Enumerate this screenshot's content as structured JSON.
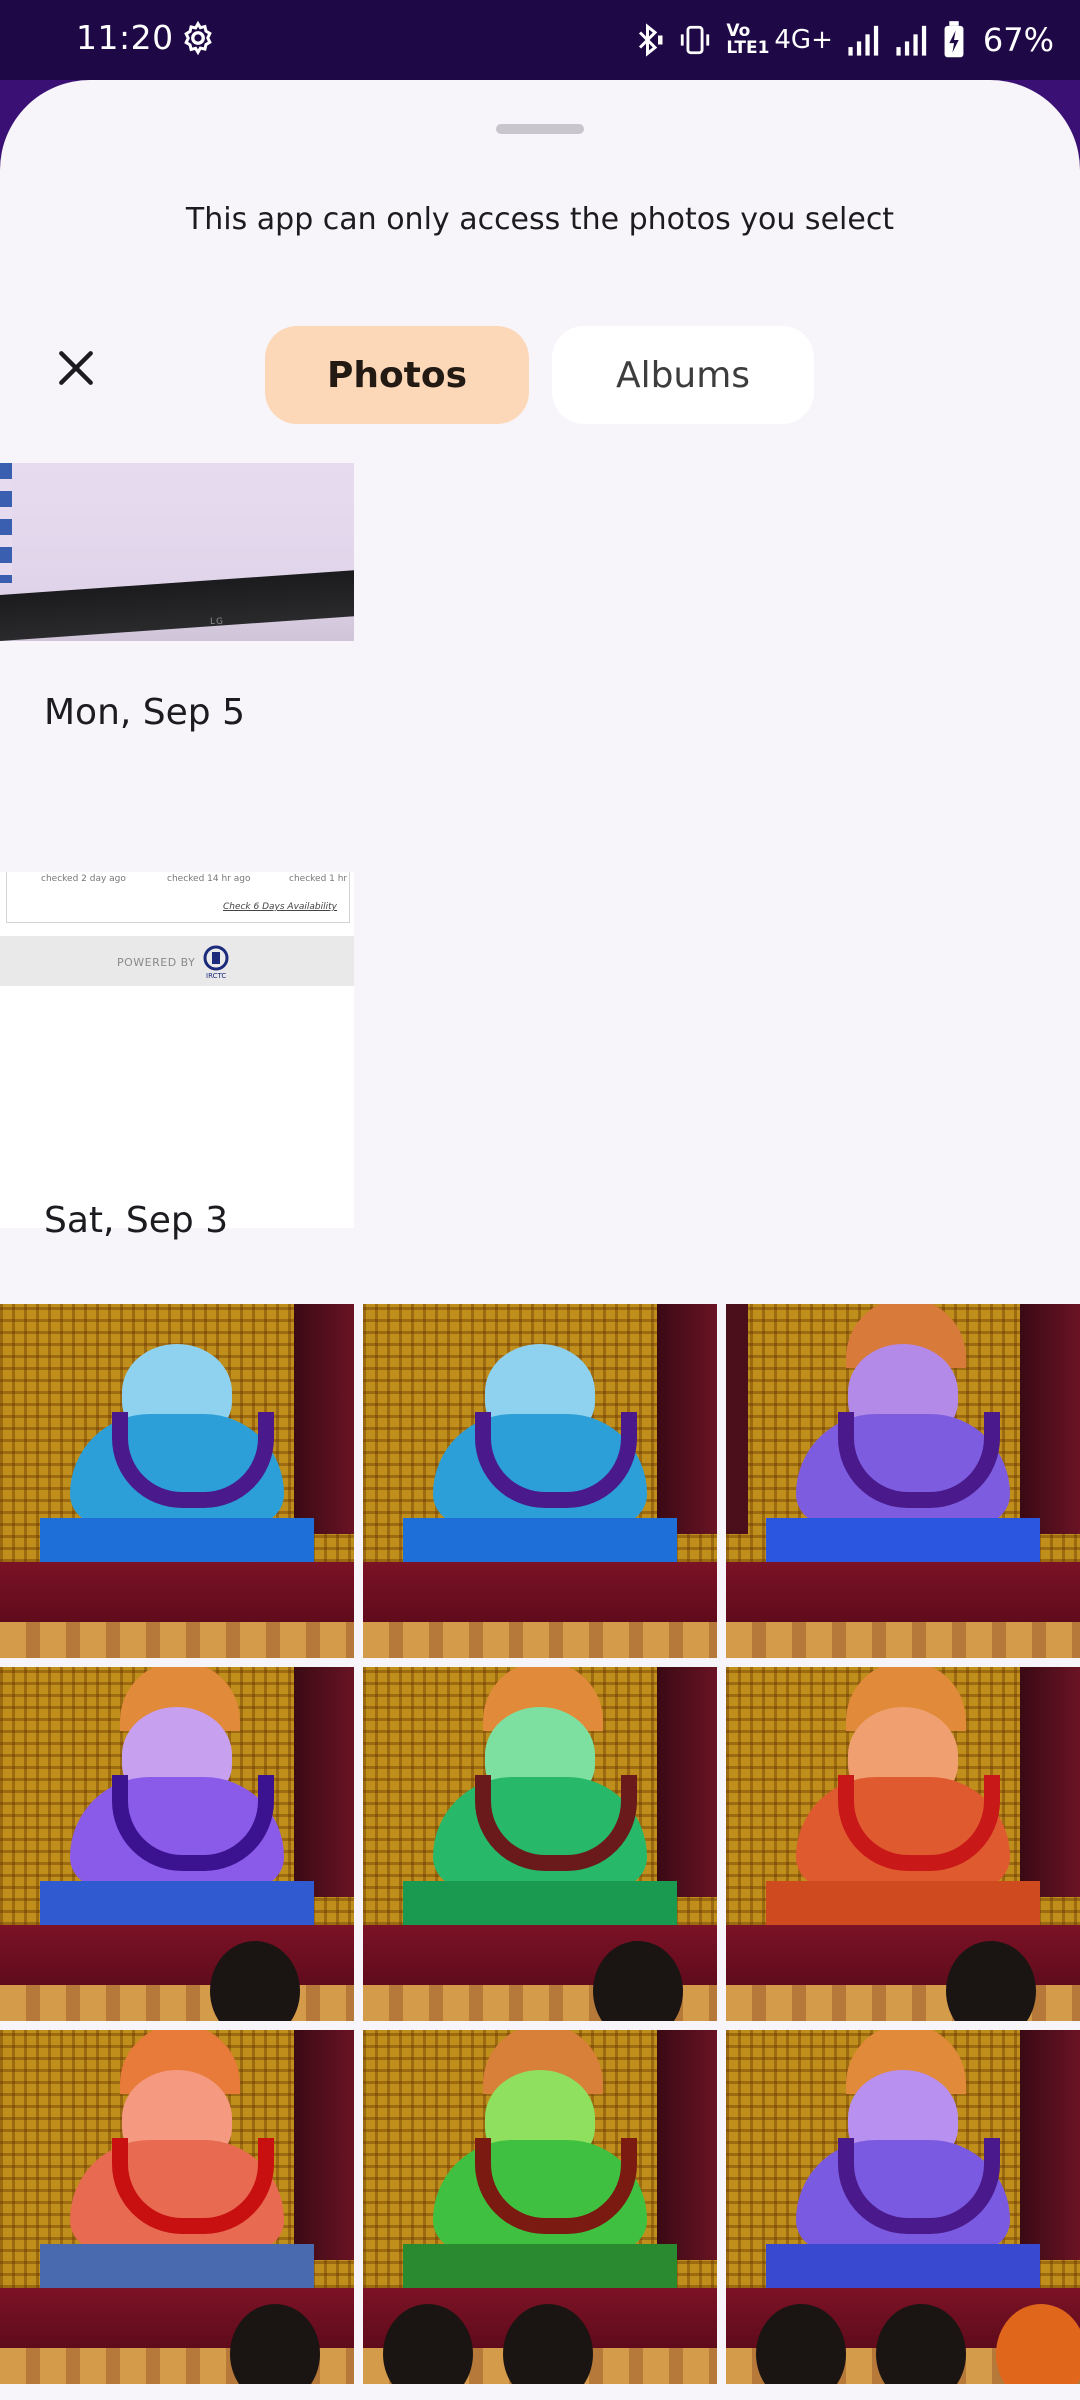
{
  "status_bar": {
    "time": "11:20",
    "network_label": "4G+",
    "volte_label": "Vo LTE1",
    "battery_percent": "67%",
    "icons": [
      "settings-gear-icon",
      "bluetooth-icon",
      "vibrate-icon",
      "volte-icon",
      "signal-icon",
      "signal-icon",
      "battery-charging-icon"
    ]
  },
  "sheet": {
    "message": "This app can only access the photos you select",
    "close_icon": "close-icon",
    "tabs": [
      {
        "label": "Photos",
        "selected": true
      },
      {
        "label": "Albums",
        "selected": false
      }
    ]
  },
  "sections": [
    {
      "date": "Mon, Sep 5"
    },
    {
      "date": "Sat, Sep 3"
    }
  ],
  "irctc_thumb": {
    "mini_1": "checked 2 day ago",
    "mini_2": "checked 14 hr ago",
    "mini_3": "checked 1 hr",
    "link": "Check 6 Days Availability",
    "powered": "POWERED BY",
    "logo_text": "IRCTC"
  },
  "monitor_thumb": {
    "logo_text": "LG"
  },
  "colors": {
    "status_bg": "#1f0846",
    "sheet_bg": "#f7f5fa",
    "tab_selected": "#fcd8b9",
    "tab_unselected": "#ffffff"
  }
}
